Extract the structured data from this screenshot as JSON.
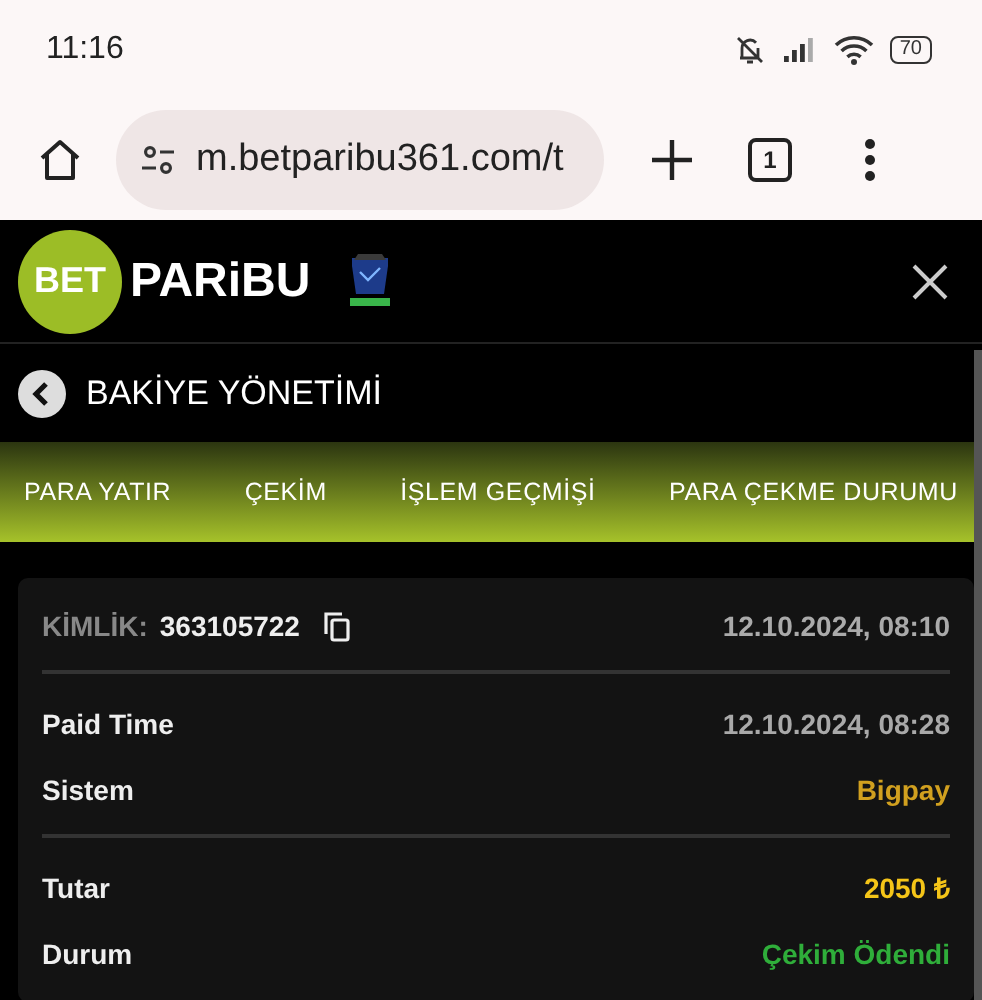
{
  "status_bar": {
    "time": "11:16",
    "battery": "70"
  },
  "browser": {
    "url": "m.betparibu361.com/t",
    "tab_count": "1"
  },
  "header": {
    "logo_badge": "BET",
    "logo_text": "PARiBU"
  },
  "page_title": "BAKİYE YÖNETİMİ",
  "tabs": [
    {
      "label": "PARA YATIR"
    },
    {
      "label": "ÇEKİM"
    },
    {
      "label": "İŞLEM GEÇMİŞİ"
    },
    {
      "label": "PARA ÇEKME DURUMU"
    }
  ],
  "card": {
    "id_label": "KİMLİK:",
    "id_value": "363105722",
    "created": "12.10.2024, 08:10",
    "groups": [
      [
        {
          "label": "Paid Time",
          "value": "12.10.2024, 08:28",
          "color": "#a9a9a9"
        },
        {
          "label": "Sistem",
          "value": "Bigpay",
          "color": "#d1a01f"
        }
      ],
      [
        {
          "label": "Tutar",
          "value": "2050 ₺",
          "color": "#f5c518"
        },
        {
          "label": "Durum",
          "value": "Çekim Ödendi",
          "color": "#2fae3a"
        }
      ]
    ]
  }
}
